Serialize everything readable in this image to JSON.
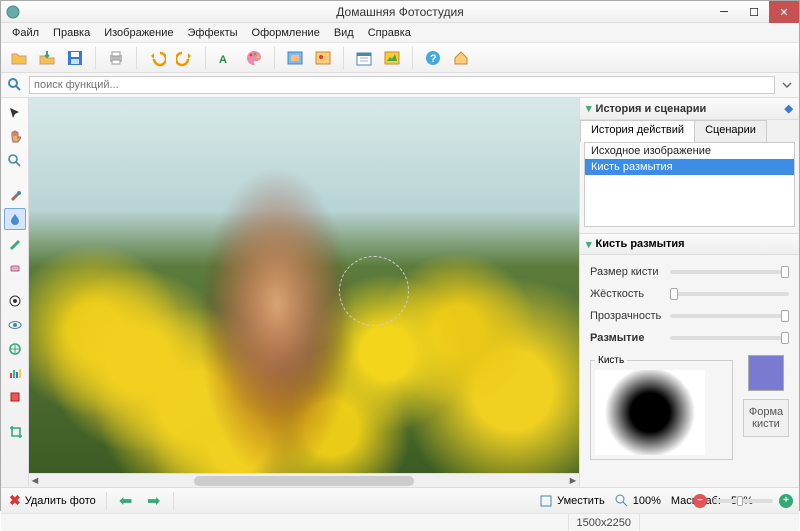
{
  "window": {
    "title": "Домашняя Фотостудия"
  },
  "menu": [
    "Файл",
    "Правка",
    "Изображение",
    "Эффекты",
    "Оформление",
    "Вид",
    "Справка"
  ],
  "search": {
    "placeholder": "поиск функций..."
  },
  "rightPanel": {
    "title": "История и сценарии",
    "tabs": [
      "История действий",
      "Сценарии"
    ],
    "history": [
      "Исходное изображение",
      "Кисть размытия"
    ],
    "section": "Кисть размытия",
    "props": {
      "size": "Размер кисти",
      "hardness": "Жёсткость",
      "opacity": "Прозрачность",
      "blur": "Размытие"
    },
    "brushLegend": "Кисть",
    "shapeBtn": "Форма кисти"
  },
  "bottom": {
    "delete": "Удалить фото",
    "fit": "Уместить",
    "hundred": "100%",
    "scaleLabel": "Масштаб:",
    "scale": "50%"
  },
  "status": {
    "dims": "1500x2250"
  }
}
